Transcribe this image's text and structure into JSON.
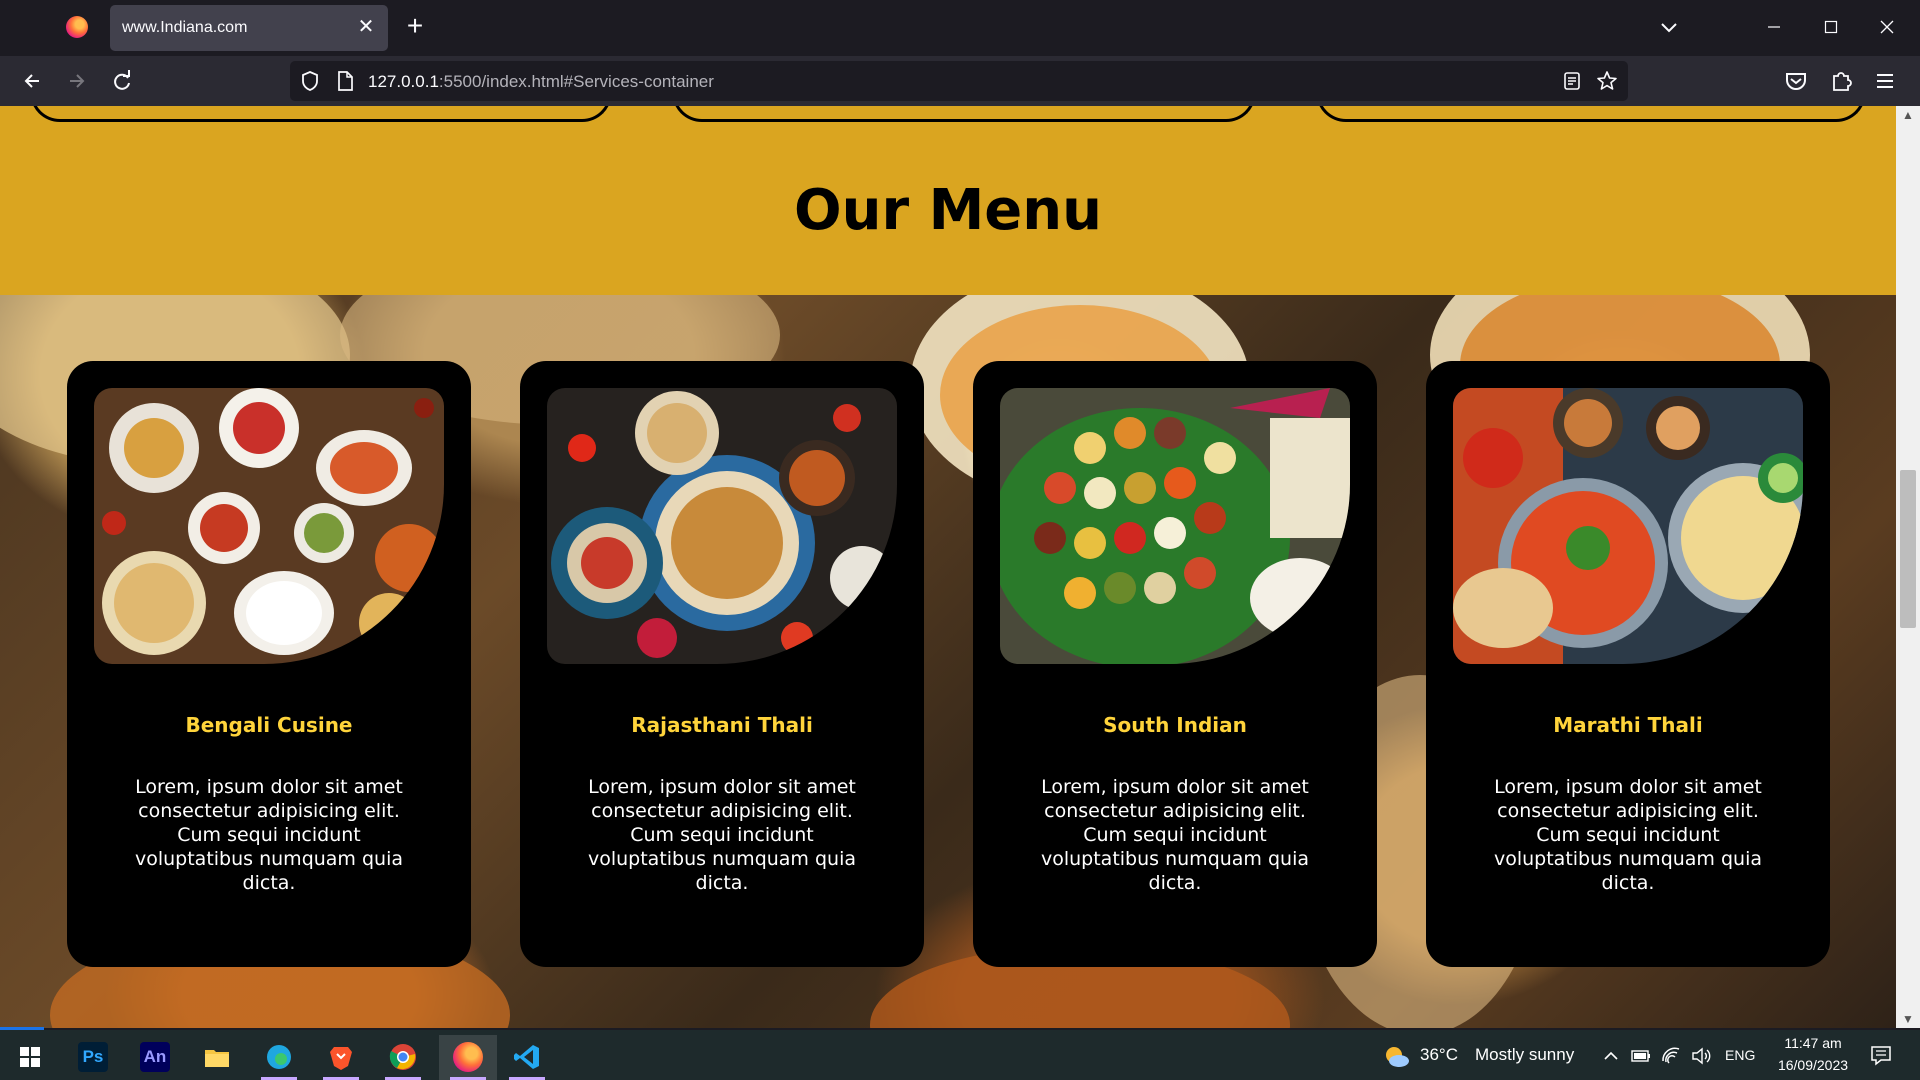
{
  "browser": {
    "tab_title": "www.Indiana.com",
    "url_host": "127.0.0.1",
    "url_rest": ":5500/index.html#Services-container"
  },
  "page": {
    "section_title": "Our Menu",
    "cards": [
      {
        "title": "Bengali Cusine",
        "description": "Lorem, ipsum dolor sit amet consectetur adipisicing elit. Cum sequi incidunt voluptatibus numquam quia dicta.",
        "image": "bengali-food-photo"
      },
      {
        "title": "Rajasthani Thali",
        "description": "Lorem, ipsum dolor sit amet consectetur adipisicing elit. Cum sequi incidunt voluptatibus numquam quia dicta.",
        "image": "rajasthani-food-photo"
      },
      {
        "title": "South Indian",
        "description": "Lorem, ipsum dolor sit amet consectetur adipisicing elit. Cum sequi incidunt voluptatibus numquam quia dicta.",
        "image": "south-indian-thali-photo"
      },
      {
        "title": "Marathi Thali",
        "description": "Lorem, ipsum dolor sit amet consectetur adipisicing elit. Cum sequi incidunt voluptatibus numquam quia dicta.",
        "image": "marathi-food-photo"
      }
    ],
    "colors": {
      "section_bg": "#daa520",
      "card_bg": "#000000",
      "card_title": "#ffd43b",
      "card_text": "#ffffff"
    }
  },
  "taskbar": {
    "apps": [
      "start-icon",
      "photoshop-icon",
      "animate-icon",
      "file-explorer-icon",
      "edge-icon",
      "brave-icon",
      "chrome-icon",
      "firefox-icon",
      "vscode-icon"
    ],
    "ps_label": "Ps",
    "an_label": "An",
    "weather_temp": "36°C",
    "weather_desc": "Mostly sunny",
    "language": "ENG",
    "time": "11:47 am",
    "date": "16/09/2023"
  }
}
